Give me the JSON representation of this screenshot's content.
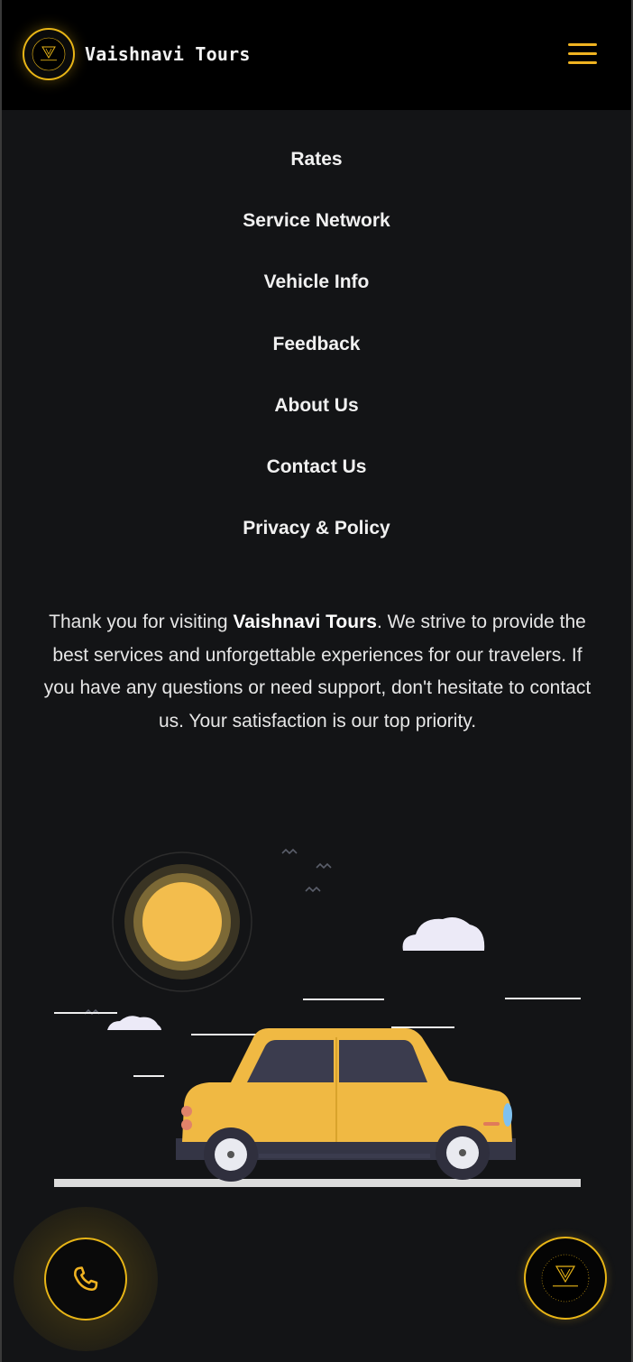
{
  "header": {
    "brand": "Vaishnavi Tours",
    "logo_icon": "vaishnavi-tours-logo-icon",
    "menu_icon": "hamburger-menu-icon"
  },
  "menu": {
    "items": [
      {
        "label": "Rates"
      },
      {
        "label": "Service Network"
      },
      {
        "label": "Vehicle Info"
      },
      {
        "label": "Feedback"
      },
      {
        "label": "About Us"
      },
      {
        "label": "Contact Us"
      },
      {
        "label": "Privacy & Policy"
      }
    ]
  },
  "footer_text": {
    "before": "Thank you for visiting ",
    "brand": "Vaishnavi Tours",
    "after": ". We strive to provide the best services and unforgettable experiences for our travelers. If you have any questions or need support, don't hesitate to contact us. Your satisfaction is our top priority."
  },
  "fab": {
    "call_icon": "phone-icon",
    "logo_icon": "vaishnavi-tours-logo-icon"
  },
  "colors": {
    "accent": "#e8b516",
    "background": "#131416",
    "header": "#000000",
    "car": "#f0b943"
  }
}
